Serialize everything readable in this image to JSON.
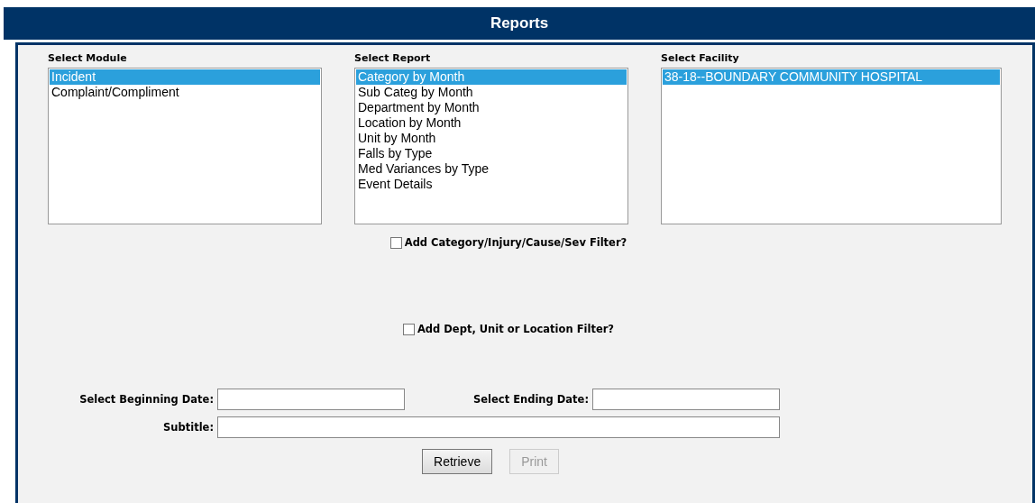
{
  "header": {
    "title": "Reports"
  },
  "lists": [
    {
      "label": "Select Module",
      "items": [
        {
          "text": "Incident",
          "selected": true
        },
        {
          "text": "Complaint/Compliment",
          "selected": false
        }
      ]
    },
    {
      "label": "Select Report",
      "items": [
        {
          "text": "Category by Month",
          "selected": true
        },
        {
          "text": "Sub Categ by Month",
          "selected": false
        },
        {
          "text": "Department by Month",
          "selected": false
        },
        {
          "text": "Location by Month",
          "selected": false
        },
        {
          "text": "Unit by Month",
          "selected": false
        },
        {
          "text": "Falls by Type",
          "selected": false
        },
        {
          "text": "Med Variances by Type",
          "selected": false
        },
        {
          "text": "Event Details",
          "selected": false
        }
      ]
    },
    {
      "label": "Select Facility",
      "items": [
        {
          "text": "38-18--BOUNDARY COMMUNITY HOSPITAL",
          "selected": true
        }
      ]
    }
  ],
  "filters": [
    {
      "label": "Add Category/Injury/Cause/Sev Filter?",
      "checked": false
    },
    {
      "label": "Add Dept, Unit or Location Filter?",
      "checked": false
    }
  ],
  "dates": {
    "begin_label": "Select Beginning Date:",
    "end_label": "Select Ending Date:",
    "subtitle_label": "Subtitle:"
  },
  "buttons": [
    {
      "label": "Retrieve",
      "disabled": false
    },
    {
      "label": "Print",
      "disabled": true
    }
  ]
}
